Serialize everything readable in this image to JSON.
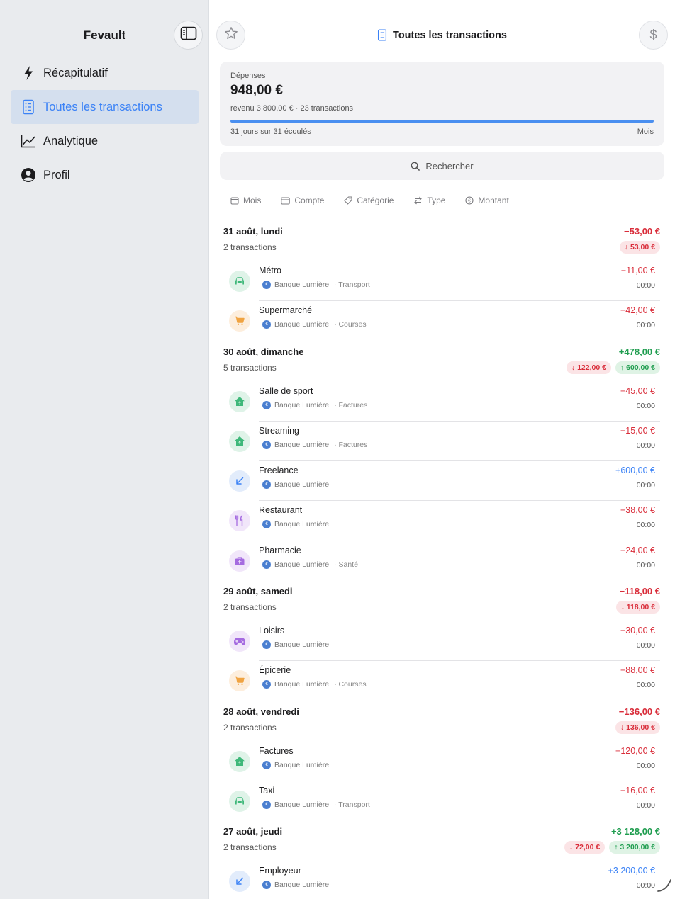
{
  "sidebar": {
    "title": "Fevault",
    "items": [
      {
        "label": "Récapitulatif",
        "icon": "bolt-icon",
        "active": false
      },
      {
        "label": "Toutes les transactions",
        "icon": "list-icon",
        "active": true
      },
      {
        "label": "Analytique",
        "icon": "chart-icon",
        "active": false
      },
      {
        "label": "Profil",
        "icon": "person-icon",
        "active": false
      }
    ]
  },
  "header": {
    "title": "Toutes les transactions",
    "currency_symbol": "$"
  },
  "summary": {
    "label": "Dépenses",
    "amount": "948,00 €",
    "subtitle": "revenu 3 800,00 € · 23 transactions",
    "progress_text": "31 jours sur 31 écoulés",
    "period": "Mois",
    "progress_fraction": 1.0
  },
  "search": {
    "placeholder": "Rechercher"
  },
  "filters": [
    {
      "label": "Mois",
      "icon": "calendar-icon"
    },
    {
      "label": "Compte",
      "icon": "card-icon"
    },
    {
      "label": "Catégorie",
      "icon": "tag-icon"
    },
    {
      "label": "Type",
      "icon": "swap-icon"
    },
    {
      "label": "Montant",
      "icon": "coin-icon"
    }
  ],
  "days": [
    {
      "title": "31 août, lundi",
      "count": "2 transactions",
      "total": "−53,00 €",
      "total_kind": "neg",
      "badges": [
        {
          "text": "↓ 53,00 €",
          "kind": "out"
        }
      ],
      "transactions": [
        {
          "name": "Métro",
          "bank": "Banque Lumière",
          "category": "· Transport",
          "amount": "−11,00 €",
          "kind": "neg",
          "time": "00:00",
          "icon": "car-icon"
        },
        {
          "name": "Supermarché",
          "bank": "Banque Lumière",
          "category": "· Courses",
          "amount": "−42,00 €",
          "kind": "neg",
          "time": "00:00",
          "icon": "cart-icon"
        }
      ]
    },
    {
      "title": "30 août, dimanche",
      "count": "5 transactions",
      "total": "+478,00 €",
      "total_kind": "pos",
      "badges": [
        {
          "text": "↓ 122,00 €",
          "kind": "out"
        },
        {
          "text": "↑ 600,00 €",
          "kind": "in"
        }
      ],
      "transactions": [
        {
          "name": "Salle de sport",
          "bank": "Banque Lumière",
          "category": "· Factures",
          "amount": "−45,00 €",
          "kind": "neg",
          "time": "00:00",
          "icon": "house-bolt-icon"
        },
        {
          "name": "Streaming",
          "bank": "Banque Lumière",
          "category": "· Factures",
          "amount": "−15,00 €",
          "kind": "neg",
          "time": "00:00",
          "icon": "house-bolt-icon"
        },
        {
          "name": "Freelance",
          "bank": "Banque Lumière",
          "category": "",
          "amount": "+600,00 €",
          "kind": "inc",
          "time": "00:00",
          "icon": "arrow-down-left-icon"
        },
        {
          "name": "Restaurant",
          "bank": "Banque Lumière",
          "category": "",
          "amount": "−38,00 €",
          "kind": "neg",
          "time": "00:00",
          "icon": "fork-knife-icon"
        },
        {
          "name": "Pharmacie",
          "bank": "Banque Lumière",
          "category": "· Santé",
          "amount": "−24,00 €",
          "kind": "neg",
          "time": "00:00",
          "icon": "medkit-icon"
        }
      ]
    },
    {
      "title": "29 août, samedi",
      "count": "2 transactions",
      "total": "−118,00 €",
      "total_kind": "neg",
      "badges": [
        {
          "text": "↓ 118,00 €",
          "kind": "out"
        }
      ],
      "transactions": [
        {
          "name": "Loisirs",
          "bank": "Banque Lumière",
          "category": "",
          "amount": "−30,00 €",
          "kind": "neg",
          "time": "00:00",
          "icon": "gamepad-icon"
        },
        {
          "name": "Épicerie",
          "bank": "Banque Lumière",
          "category": "· Courses",
          "amount": "−88,00 €",
          "kind": "neg",
          "time": "00:00",
          "icon": "cart-icon"
        }
      ]
    },
    {
      "title": "28 août, vendredi",
      "count": "2 transactions",
      "total": "−136,00 €",
      "total_kind": "neg",
      "badges": [
        {
          "text": "↓ 136,00 €",
          "kind": "out"
        }
      ],
      "transactions": [
        {
          "name": "Factures",
          "bank": "Banque Lumière",
          "category": "",
          "amount": "−120,00 €",
          "kind": "neg",
          "time": "00:00",
          "icon": "house-bolt-icon"
        },
        {
          "name": "Taxi",
          "bank": "Banque Lumière",
          "category": "· Transport",
          "amount": "−16,00 €",
          "kind": "neg",
          "time": "00:00",
          "icon": "car-icon"
        }
      ]
    },
    {
      "title": "27 août, jeudi",
      "count": "2 transactions",
      "total": "+3 128,00 €",
      "total_kind": "pos",
      "badges": [
        {
          "text": "↓ 72,00 €",
          "kind": "out"
        },
        {
          "text": "↑ 3 200,00 €",
          "kind": "in"
        }
      ],
      "transactions": [
        {
          "name": "Employeur",
          "bank": "Banque Lumière",
          "category": "",
          "amount": "+3 200,00 €",
          "kind": "inc",
          "time": "00:00",
          "icon": "arrow-down-left-icon"
        }
      ]
    }
  ],
  "colors": {
    "accent": "#3b82f6",
    "expense": "#d92d3a",
    "income_total": "#1f9d4f",
    "income_item": "#3b82f6"
  }
}
